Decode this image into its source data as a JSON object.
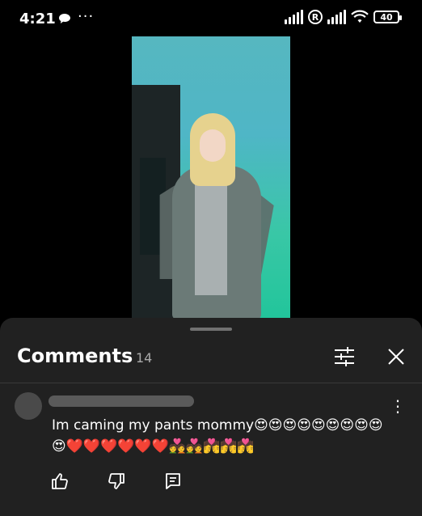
{
  "status_bar": {
    "time": "4:21",
    "dots": "···",
    "r_label": "R",
    "battery": "40"
  },
  "video": {
    "description_icon": "video-frame"
  },
  "comments_panel": {
    "title": "Comments",
    "count": "14",
    "filter_icon": "sliders-icon",
    "close_icon": "close-icon"
  },
  "comment": {
    "author": "",
    "text": "Im caming my pants mommy😍😍😍😍😍😍😍😍😍😍❤️❤️❤️❤️❤️❤️💑💑💏💏💏",
    "more_icon": "more-vert-icon",
    "actions": [
      "like",
      "dislike",
      "reply"
    ]
  }
}
